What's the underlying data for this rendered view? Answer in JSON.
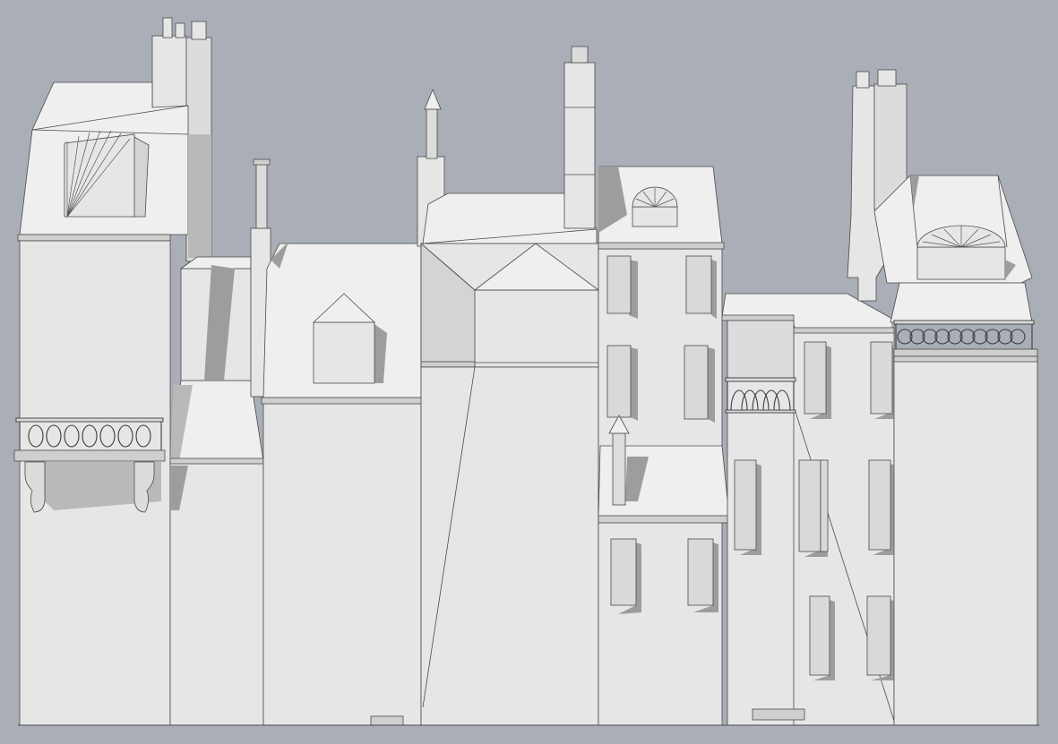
{
  "scene": {
    "subject": "",
    "colors": {
      "background": "#a9aeb7",
      "wall": "#e6e6e6",
      "shadow": "#9d9d9d",
      "outline": "#4a4a4a"
    }
  }
}
